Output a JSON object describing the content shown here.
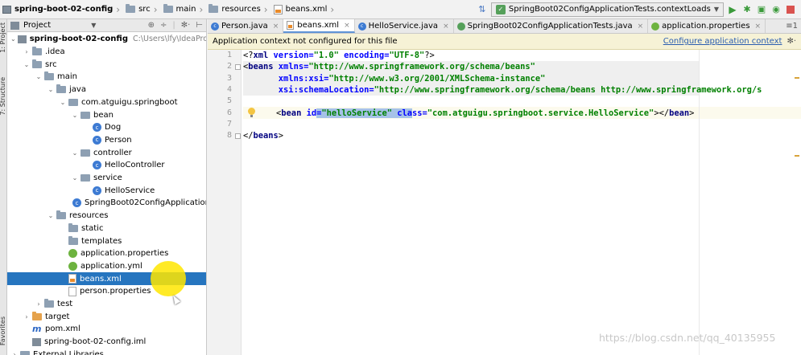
{
  "nav": {
    "breadcrumbs": [
      {
        "label": "spring-boot-02-config",
        "icon": "project-icon",
        "bold": true
      },
      {
        "label": "src",
        "icon": "folder-icon"
      },
      {
        "label": "main",
        "icon": "folder-icon"
      },
      {
        "label": "resources",
        "icon": "resources-folder-icon"
      },
      {
        "label": "beans.xml",
        "icon": "xml-file-icon"
      }
    ],
    "run_config": "SpringBoot02ConfigApplicationTests.contextLoads",
    "tool_icons": [
      "build-icon",
      "run-icon",
      "debug-icon",
      "coverage-icon",
      "profile-icon",
      "stop-icon"
    ]
  },
  "left_stripe": {
    "tabs": [
      "1: Project",
      "7: Structure",
      "Favorites"
    ]
  },
  "project": {
    "title": "Project",
    "tree": [
      {
        "label": "spring-boot-02-config",
        "hint": "C:\\Users\\lfy\\IdeaProjects",
        "depth": 0,
        "arrow": "down",
        "icon": "project",
        "bold": true
      },
      {
        "label": ".idea",
        "depth": 1,
        "arrow": "right",
        "icon": "folder"
      },
      {
        "label": "src",
        "depth": 1,
        "arrow": "down",
        "icon": "folder"
      },
      {
        "label": "main",
        "depth": 2,
        "arrow": "down",
        "icon": "folder"
      },
      {
        "label": "java",
        "depth": 3,
        "arrow": "down",
        "icon": "folder-blue"
      },
      {
        "label": "com.atguigu.springboot",
        "depth": 4,
        "arrow": "down",
        "icon": "package"
      },
      {
        "label": "bean",
        "depth": 5,
        "arrow": "down",
        "icon": "package"
      },
      {
        "label": "Dog",
        "depth": 6,
        "arrow": "",
        "icon": "class"
      },
      {
        "label": "Person",
        "depth": 6,
        "arrow": "",
        "icon": "class"
      },
      {
        "label": "controller",
        "depth": 5,
        "arrow": "down",
        "icon": "package"
      },
      {
        "label": "HelloController",
        "depth": 6,
        "arrow": "",
        "icon": "class"
      },
      {
        "label": "service",
        "depth": 5,
        "arrow": "down",
        "icon": "package"
      },
      {
        "label": "HelloService",
        "depth": 6,
        "arrow": "",
        "icon": "class"
      },
      {
        "label": "SpringBoot02ConfigApplication",
        "depth": 5,
        "arrow": "",
        "icon": "spring-class"
      },
      {
        "label": "resources",
        "depth": 3,
        "arrow": "down",
        "icon": "folder-res"
      },
      {
        "label": "static",
        "depth": 4,
        "arrow": "",
        "icon": "folder"
      },
      {
        "label": "templates",
        "depth": 4,
        "arrow": "",
        "icon": "folder"
      },
      {
        "label": "application.properties",
        "depth": 4,
        "arrow": "",
        "icon": "spring"
      },
      {
        "label": "application.yml",
        "depth": 4,
        "arrow": "",
        "icon": "spring"
      },
      {
        "label": "beans.xml",
        "depth": 4,
        "arrow": "",
        "icon": "xml",
        "selected": true
      },
      {
        "label": "person.properties",
        "depth": 4,
        "arrow": "",
        "icon": "file"
      },
      {
        "label": "test",
        "depth": 2,
        "arrow": "right",
        "icon": "folder"
      },
      {
        "label": "target",
        "depth": 1,
        "arrow": "right",
        "icon": "folder-orange"
      },
      {
        "label": "pom.xml",
        "depth": 1,
        "arrow": "",
        "icon": "maven"
      },
      {
        "label": "spring-boot-02-config.iml",
        "depth": 1,
        "arrow": "",
        "icon": "iml"
      },
      {
        "label": "External Libraries",
        "depth": 0,
        "arrow": "right",
        "icon": "library"
      }
    ]
  },
  "editor": {
    "tabs": [
      {
        "label": "Person.java",
        "icon": "class",
        "active": false
      },
      {
        "label": "beans.xml",
        "icon": "xml",
        "active": true
      },
      {
        "label": "HelloService.java",
        "icon": "class",
        "active": false
      },
      {
        "label": "SpringBoot02ConfigApplicationTests.java",
        "icon": "junit",
        "active": false
      },
      {
        "label": "application.properties",
        "icon": "spring",
        "active": false
      }
    ],
    "tabs_menu": "≡1",
    "banner": {
      "message": "Application context not configured for this file",
      "link": "Configure application context"
    },
    "line_numbers": [
      "1",
      "2",
      "3",
      "4",
      "5",
      "6",
      "7",
      "8"
    ],
    "code": {
      "line1": {
        "open": "<?",
        "tag": "xml",
        "a1": " version=",
        "v1": "\"1.0\"",
        "a2": " encoding=",
        "v2": "\"UTF-8\"",
        "close": "?>"
      },
      "line2": {
        "open": "<",
        "tag": "beans",
        "a1": " xmlns=",
        "v1": "\"http://www.springframework.org/schema/beans\""
      },
      "line3": {
        "indent": "       ",
        "a1": "xmlns:xsi=",
        "v1": "\"http://www.w3.org/2001/XMLSchema-instance\""
      },
      "line4": {
        "indent": "       ",
        "a1": "xsi:schemaLocation=",
        "v1": "\"http://www.springframework.org/schema/beans http://www.springframework.org/s"
      },
      "line7": {
        "indent": "    ",
        "open": "<",
        "tag": "bean",
        "a1pre": " id",
        "a1sel": "=",
        "v1": "\"helloService\"",
        "sp": " ",
        "a2sel": "cla",
        "a2rest": "ss=",
        "v2": "\"com.atguigu.springboot.service.HelloService\"",
        "close": "></",
        "tag2": "bean",
        "close2": ">"
      },
      "line8": {
        "open": "</",
        "tag": "beans",
        "close": ">"
      }
    }
  },
  "watermark": "https://blog.csdn.net/qq_40135955"
}
